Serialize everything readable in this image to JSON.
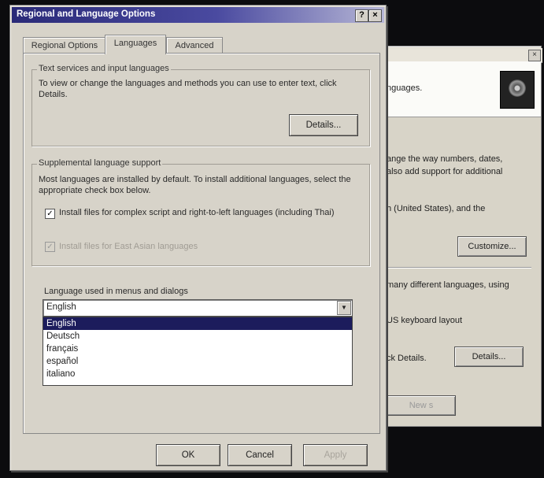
{
  "background_window": {
    "header_text": "nguages.",
    "lines": [
      "ange the way numbers, dates,",
      "also add support for additional",
      "h (United States), and the"
    ],
    "customize_label": "Customize...",
    "lines2": [
      "many different languages, using",
      "US keyboard layout",
      "ck Details."
    ],
    "details_label": "Details...",
    "bottom_button_label": "New s"
  },
  "dialog": {
    "title": "Regional and Language Options",
    "help_label": "?",
    "close_label": "×",
    "tabs": [
      {
        "label": "Regional Options",
        "active": false
      },
      {
        "label": "Languages",
        "active": true
      },
      {
        "label": "Advanced",
        "active": false
      }
    ],
    "text_services": {
      "legend": "Text services and input languages",
      "description": "To view or change the languages and methods you can use to enter text, click Details.",
      "details_label": "Details..."
    },
    "supplemental": {
      "legend": "Supplemental language support",
      "description": "Most languages are installed by default. To install additional languages, select the appropriate check box below.",
      "complex_script_label": "Install files for complex script and right-to-left languages (including Thai)",
      "complex_script_checked": true,
      "east_asian_label": "Install files for East Asian languages",
      "east_asian_checked": true,
      "east_asian_disabled": true
    },
    "ui_language": {
      "label": "Language used in menus and dialogs",
      "selected": "English",
      "options": [
        "English",
        "Deutsch",
        "français",
        "español",
        "italiano"
      ]
    },
    "buttons": {
      "ok": "OK",
      "cancel": "Cancel",
      "apply": "Apply"
    }
  }
}
